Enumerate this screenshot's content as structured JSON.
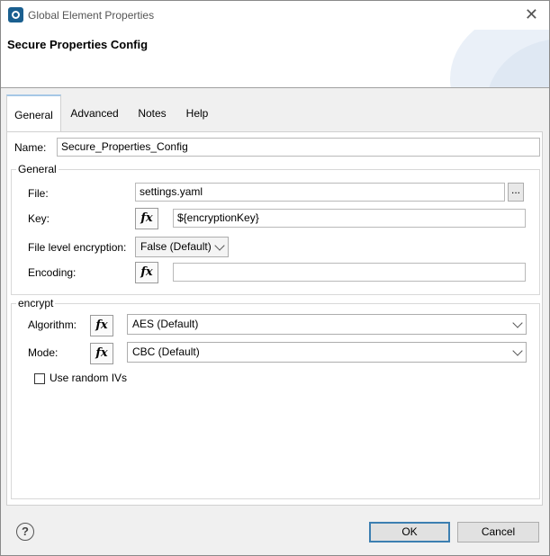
{
  "window": {
    "title": "Global Element Properties",
    "close_glyph": "✕"
  },
  "header": {
    "title": "Secure Properties Config"
  },
  "tabs": [
    {
      "label": "General",
      "active": true
    },
    {
      "label": "Advanced",
      "active": false
    },
    {
      "label": "Notes",
      "active": false
    },
    {
      "label": "Help",
      "active": false
    }
  ],
  "name_field": {
    "label": "Name:",
    "value": "Secure_Properties_Config"
  },
  "general_group": {
    "title": "General",
    "file": {
      "label": "File:",
      "value": "settings.yaml",
      "browse_label": "..."
    },
    "key": {
      "label": "Key:",
      "value": "${encryptionKey}"
    },
    "file_level_encryption": {
      "label": "File level encryption:",
      "value": "False (Default)"
    },
    "encoding": {
      "label": "Encoding:",
      "value": ""
    }
  },
  "encrypt_group": {
    "title": "encrypt",
    "algorithm": {
      "label": "Algorithm:",
      "value": "AES (Default)"
    },
    "mode": {
      "label": "Mode:",
      "value": "CBC (Default)"
    },
    "random_ivs": {
      "label": "Use random IVs",
      "checked": false
    }
  },
  "fx_label": "fx",
  "footer": {
    "help_glyph": "?",
    "ok_label": "OK",
    "cancel_label": "Cancel"
  },
  "colors": {
    "accent": "#3c7fb1",
    "brand": "#1a5f8f"
  },
  "icons": {
    "app": "mule-app-icon",
    "close": "close-icon",
    "help": "help-icon",
    "fx": "expression-fx-icon",
    "dropdown": "chevron-down-icon"
  }
}
